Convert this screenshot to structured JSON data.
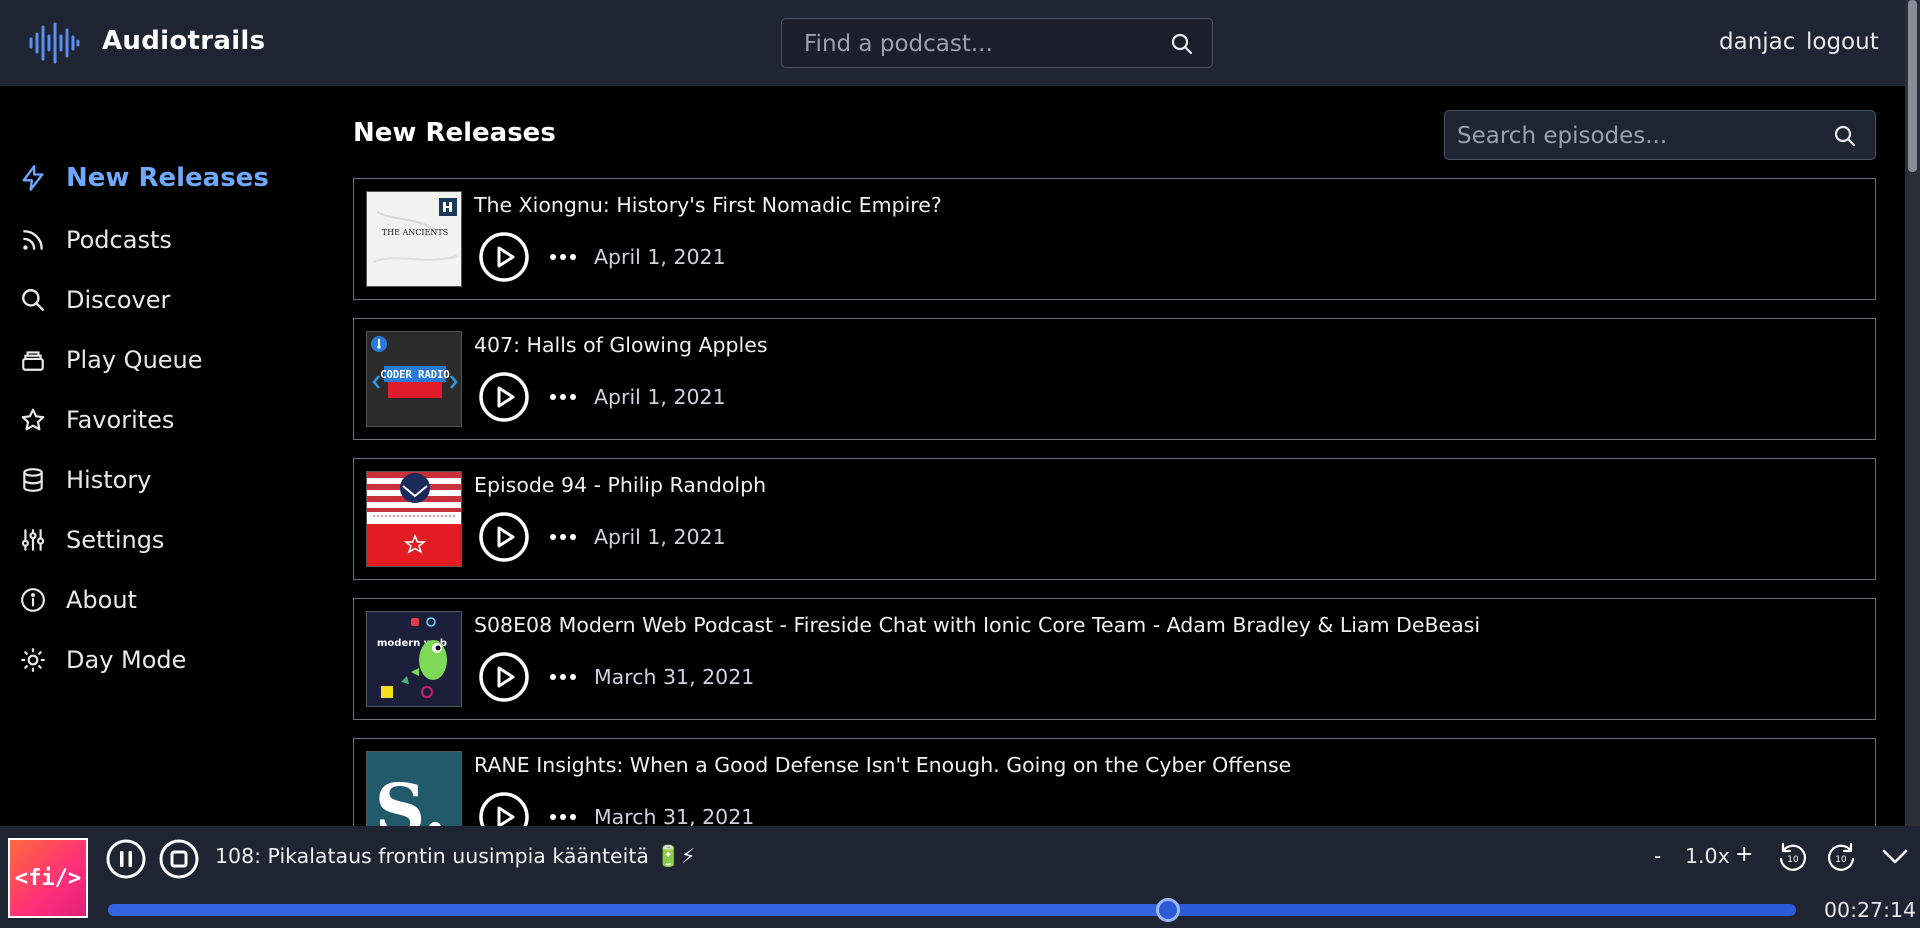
{
  "header": {
    "app_title": "Audiotrails",
    "podcast_search_placeholder": "Find a podcast...",
    "user_name": "danjac",
    "logout_label": "logout",
    "background_color": "#1e2432"
  },
  "sidebar": {
    "items": [
      {
        "label": "New Releases",
        "icon": "lightning-icon",
        "active": true
      },
      {
        "label": "Podcasts",
        "icon": "rss-icon"
      },
      {
        "label": "Discover",
        "icon": "search-icon"
      },
      {
        "label": "Play Queue",
        "icon": "stack-icon"
      },
      {
        "label": "Favorites",
        "icon": "star-icon"
      },
      {
        "label": "History",
        "icon": "database-icon"
      },
      {
        "label": "Settings",
        "icon": "sliders-icon"
      },
      {
        "label": "About",
        "icon": "info-icon"
      },
      {
        "label": "Day Mode",
        "icon": "sun-icon"
      }
    ],
    "active_color": "#6ea8ff"
  },
  "main": {
    "title": "New Releases",
    "episode_search_placeholder": "Search episodes...",
    "episodes": [
      {
        "title": "The Xiongnu: History's First Nomadic Empire?",
        "date": "April 1, 2021",
        "art": "the-ancients-art",
        "art_text": "THE ANCIENTS"
      },
      {
        "title": "407: Halls of Glowing Apples",
        "date": "April 1, 2021",
        "art": "coder-radio-art",
        "art_text": "CODER RADIO"
      },
      {
        "title": "Episode 94 - Philip Randolph",
        "date": "April 1, 2021",
        "art": "history-cold-war-art"
      },
      {
        "title": "S08E08 Modern Web Podcast - Fireside Chat with Ionic Core Team - Adam Bradley & Liam DeBeasi",
        "date": "March 31, 2021",
        "art": "modern-web-art",
        "art_text": "modern web"
      },
      {
        "title": "RANE Insights: When a Good Defense Isn't Enough. Going on the Cyber Offense",
        "date": "March 31, 2021",
        "art": "stratfor-art",
        "art_text": "S."
      }
    ]
  },
  "player": {
    "art_text": "<fi/>",
    "title": "108: Pikalataus frontin uusimpia käänteitä 🔋⚡",
    "speed_minus": "-",
    "speed": "1.0x",
    "speed_plus": "+",
    "rewind_label": "10",
    "forward_label": "10",
    "elapsed": "00:27:14",
    "progress_fraction": 0.628,
    "progress_color": "#2d5bd8"
  }
}
